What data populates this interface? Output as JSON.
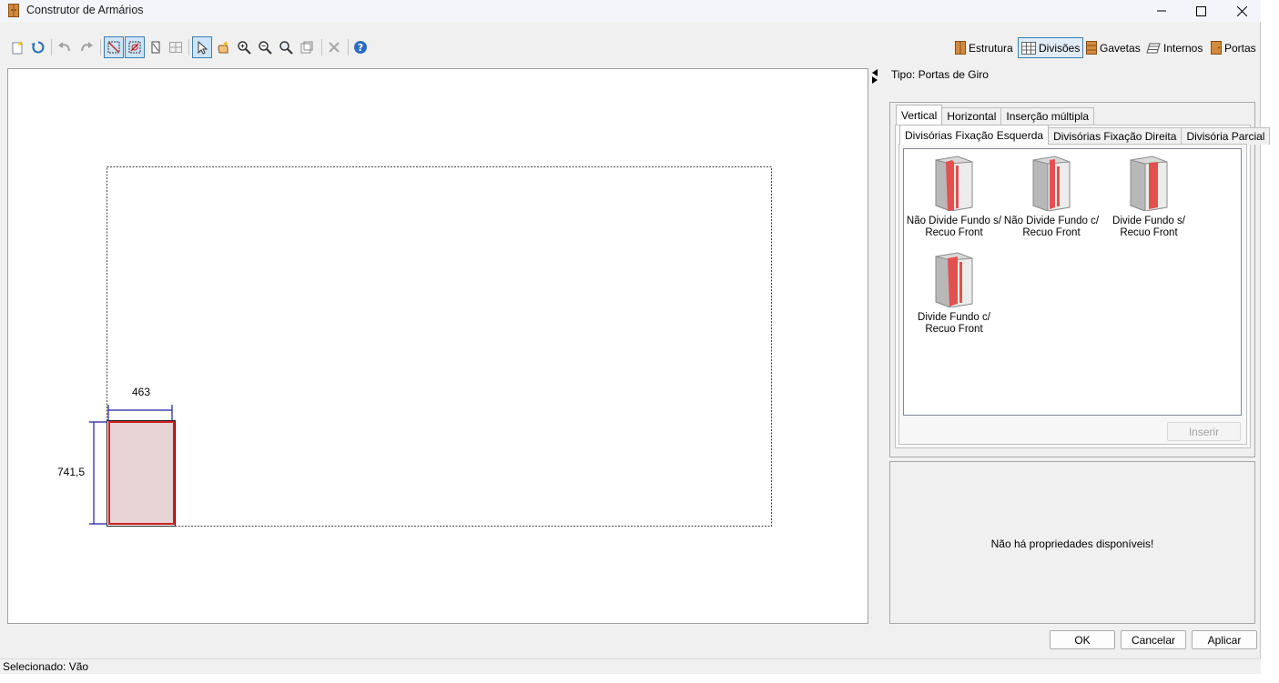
{
  "window": {
    "title": "Construtor de Armários"
  },
  "toolbar": {
    "tools": [
      "new-icon",
      "refresh-icon",
      "undo-icon",
      "redo-icon",
      "draw-select-icon",
      "erase-icon",
      "dimension-icon",
      "grid-icon",
      "pointer-icon",
      "hand-add-icon",
      "zoom-in-icon",
      "zoom-out-icon",
      "zoom-fit-icon",
      "window-icon",
      "delete-icon",
      "help-icon"
    ]
  },
  "modes": {
    "estrutura": "Estrutura",
    "divisoes": "Divisões",
    "gavetas": "Gavetas",
    "internos": "Internos",
    "portas": "Portas"
  },
  "canvas": {
    "width_label": "463",
    "height_label": "741,5"
  },
  "panel": {
    "tipo": "Tipo: Portas de Giro",
    "tabs": [
      "Vertical",
      "Horizontal",
      "Inserção múltipla"
    ],
    "subtabs": [
      "Divisórias Fixação Esquerda",
      "Divisórias Fixação Direita",
      "Divisória Parcial"
    ],
    "items": [
      {
        "label": "Não Divide Fundo s/ Recuo Front",
        "icon": "cabinet-divider-icon"
      },
      {
        "label": "Não Divide Fundo c/ Recuo Front",
        "icon": "cabinet-divider-icon"
      },
      {
        "label": "Divide Fundo s/ Recuo Front",
        "icon": "cabinet-divider-icon"
      },
      {
        "label": "Divide Fundo c/ Recuo Front",
        "icon": "cabinet-divider-icon"
      }
    ],
    "insert_button": "Inserir"
  },
  "properties": {
    "empty_message": "Não há propriedades disponíveis!"
  },
  "dialog_buttons": {
    "ok": "OK",
    "cancel": "Cancelar",
    "apply": "Aplicar"
  },
  "status": {
    "selected": "Selecionado: Vão"
  },
  "colors": {
    "accent": "#3c7fb1",
    "selection_red": "#cc1f1f",
    "selection_fill": "#e8d3d5",
    "dimension_blue": "#1f1f9c"
  }
}
